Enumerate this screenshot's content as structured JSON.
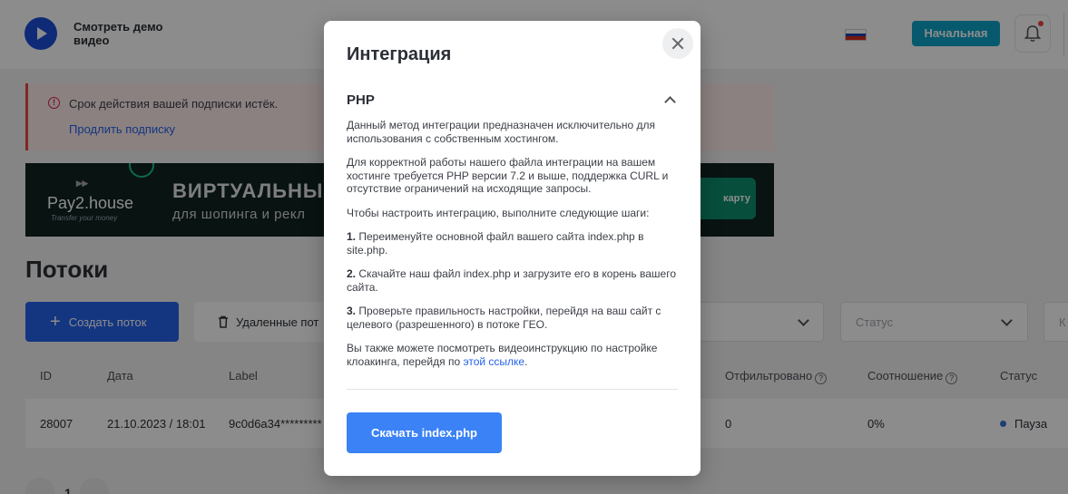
{
  "header": {
    "demo_label": "Смотреть демо видео",
    "plan_badge": "Начальная"
  },
  "alert": {
    "message": "Срок действия вашей подписки истёк.",
    "link": "Продлить подписку"
  },
  "banner": {
    "logo": "Pay2.house",
    "tagline": "Transfer your money",
    "headline": "ВИРТУАЛЬНЫ",
    "subline": "для шопинга и рекл",
    "cta": "карту"
  },
  "page": {
    "title": "Потоки",
    "create_button": "Создать поток",
    "deleted_button": "Удаленные пот",
    "status_placeholder": "Статус",
    "next_filter_placeholder": "К"
  },
  "table": {
    "columns": {
      "id": "ID",
      "date": "Дата",
      "label": "Label",
      "filtered": "Отфильтровано",
      "ratio": "Соотношение",
      "status": "Статус"
    },
    "rows": [
      {
        "id": "28007",
        "date": "21.10.2023 / 18:01",
        "label": "9c0d6a34*********",
        "filtered": "0",
        "ratio": "0%",
        "status": "Пауза"
      }
    ]
  },
  "pagination": {
    "current": "1"
  },
  "modal": {
    "title": "Интеграция",
    "section_title": "PHP",
    "intro": "Данный метод интеграции предназначен исключительно для использования с собственным хостингом.",
    "requirements": "Для корректной работы нашего файла интеграции на вашем хостинге требуется PHP версии 7.2 и выше, поддержка CURL и отсутствие ограничений на исходящие запросы.",
    "steps_intro": "Чтобы настроить интеграцию, выполните следующие шаги:",
    "step1_num": "1.",
    "step1": "Переименуйте основной файл вашего сайта index.php в site.php.",
    "step2_num": "2.",
    "step2": "Скачайте наш файл index.php и загрузите его в корень вашего сайта.",
    "step3_num": "3.",
    "step3": "Проверьте правильность настройки, перейдя на ваш сайт с целевого (разрешенного) в потоке ГЕО.",
    "video_text": "Вы также можете посмотреть видеоинструкцию по настройке клоакинга, перейдя по",
    "video_link": "этой ссылке",
    "video_end": ".",
    "download_button": "Скачать index.php"
  },
  "colors": {
    "primary": "#2563eb",
    "download": "#3b82f6",
    "plan_badge": "#0ea5c8",
    "alert_bg": "#fdecec",
    "alert_accent": "#ef4444"
  }
}
